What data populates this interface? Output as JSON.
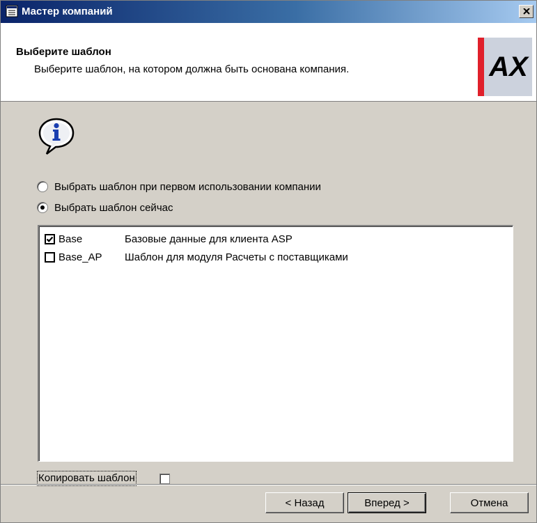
{
  "window": {
    "title": "Мастер компаний"
  },
  "header": {
    "title": "Выберите шаблон",
    "subtitle": "Выберите шаблон, на котором должна быть основана компания.",
    "logo_text": "AX",
    "logo_color": "#e0202b"
  },
  "options": {
    "later_label": "Выбрать шаблон при первом использовании компании",
    "now_label": "Выбрать шаблон сейчас",
    "selected": "now"
  },
  "templates": [
    {
      "name": "Base",
      "description": "Базовые данные для клиента ASP",
      "checked": true
    },
    {
      "name": "Base_AP",
      "description": "Шаблон для модуля Расчеты с поставщиками",
      "checked": false
    }
  ],
  "copy_template": {
    "label": "Копировать шаблон",
    "checked": false
  },
  "buttons": {
    "back": "< Назад",
    "next": "Вперед >",
    "cancel": "Отмена"
  },
  "icons": {
    "app": "window-icon",
    "close": "close-icon",
    "info": "info-icon"
  }
}
